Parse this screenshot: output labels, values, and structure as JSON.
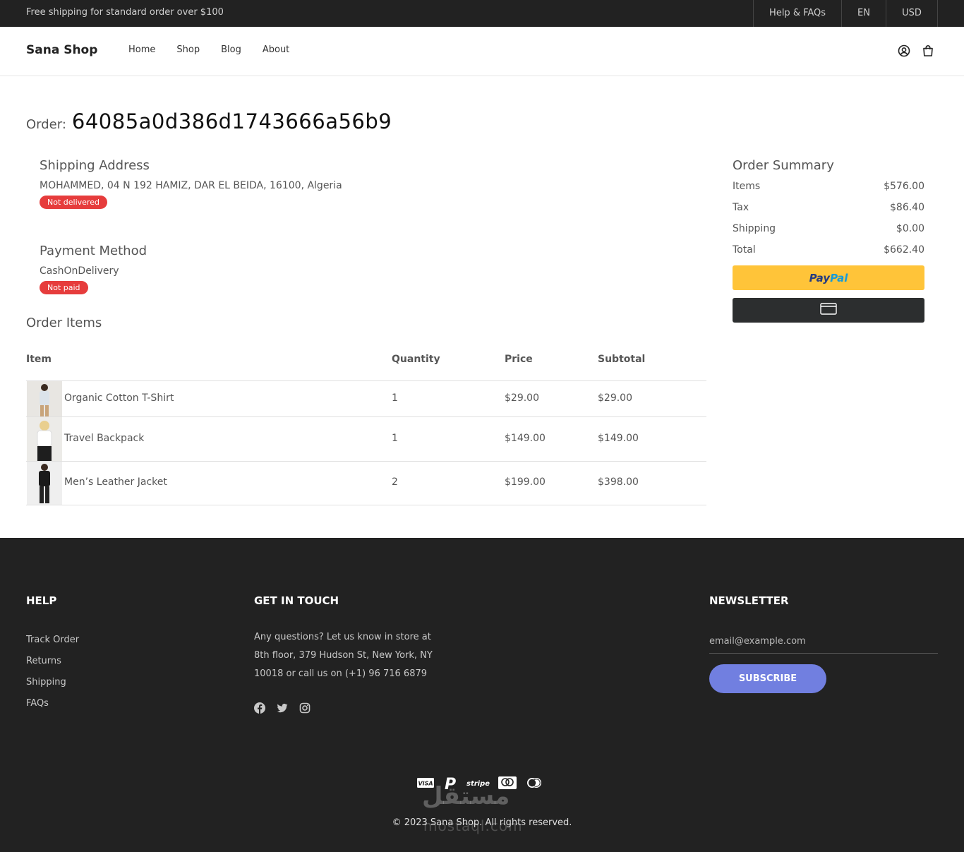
{
  "topbar": {
    "promo": "Free shipping for standard order over $100",
    "links": [
      "Help & FAQs",
      "EN",
      "USD"
    ]
  },
  "header": {
    "logo": "Sana Shop",
    "nav": [
      "Home",
      "Shop",
      "Blog",
      "About"
    ],
    "icons": [
      "user-icon",
      "cart-icon"
    ]
  },
  "order": {
    "label": "Order:",
    "id": "64085a0d386d1743666a56b9"
  },
  "shipping": {
    "title": "Shipping Address",
    "address": "MOHAMMED, 04 N 192 HAMIZ, DAR EL BEIDA, 16100, Algeria",
    "status": "Not delivered"
  },
  "payment": {
    "title": "Payment Method",
    "method": "CashOnDelivery",
    "status": "Not paid"
  },
  "items": {
    "title": "Order Items",
    "headers": [
      "Item",
      "Quantity",
      "Price",
      "Subtotal"
    ],
    "rows": [
      {
        "name": "Organic Cotton T-Shirt",
        "qty": "1",
        "price": "$29.00",
        "subtotal": "$29.00"
      },
      {
        "name": "Travel Backpack",
        "qty": "1",
        "price": "$149.00",
        "subtotal": "$149.00"
      },
      {
        "name": "Men’s Leather Jacket",
        "qty": "2",
        "price": "$199.00",
        "subtotal": "$398.00"
      }
    ]
  },
  "summary": {
    "title": "Order Summary",
    "rows": [
      {
        "label": "Items",
        "value": "$576.00"
      },
      {
        "label": "Tax",
        "value": "$86.40"
      },
      {
        "label": "Shipping",
        "value": "$0.00"
      },
      {
        "label": "Total",
        "value": "$662.40"
      }
    ],
    "paypal_part1": "Pay",
    "paypal_part2": "Pal",
    "paypal_color": "#ffc439",
    "card_button_color": "#2c2e2f"
  },
  "footer": {
    "help_title": "HELP",
    "help_links": [
      "Track Order",
      "Returns",
      "Shipping",
      "FAQs"
    ],
    "contact_title": "GET IN TOUCH",
    "contact_text": "Any questions? Let us know in store at 8th floor, 379 Hudson St, New York, NY 10018 or call us on (+1) 96 716 6879",
    "social_icons": [
      "facebook-icon",
      "twitter-icon",
      "instagram-icon"
    ],
    "newsletter_title": "NEWSLETTER",
    "newsletter_placeholder": "email@example.com",
    "subscribe_label": "SUBSCRIBE",
    "subscribe_color": "#717fe0",
    "payment_icons": [
      "VISA",
      "P",
      "stripe",
      "mastercard",
      "mastercard"
    ],
    "copyright": "© 2023 Sana Shop. All rights reserved.",
    "watermark": "مستقل",
    "watermark_url": "mostaql.com"
  }
}
